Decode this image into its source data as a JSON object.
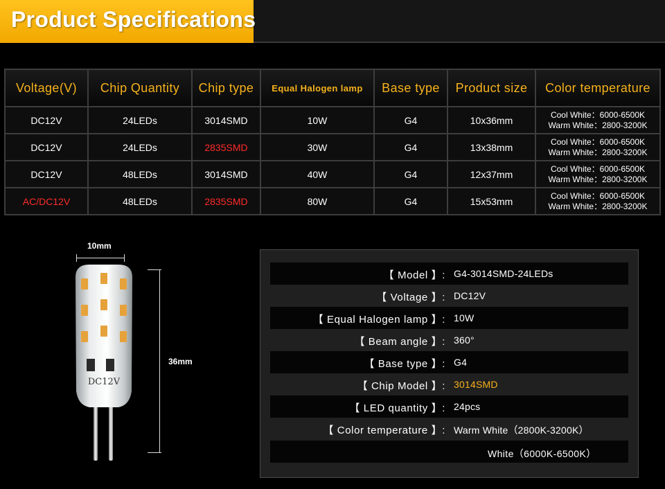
{
  "header": {
    "title": "Product  Specifications"
  },
  "table": {
    "headers": [
      "Voltage(V)",
      "Chip  Quantity",
      "Chip  type",
      "Equal  Halogen  lamp",
      "Base  type",
      "Product  size",
      "Color  temperature"
    ],
    "rows": [
      {
        "voltage": "DC12V",
        "chips": "24LEDs",
        "chip_type": "3014SMD",
        "halogen": "10W",
        "base": "G4",
        "size": "10x36mm",
        "cool": "Cool  White：6000-6500K",
        "warm": "Warm  White：2800-3200K"
      },
      {
        "voltage": "DC12V",
        "chips": "24LEDs",
        "chip_type": "2835SMD",
        "halogen": "30W",
        "base": "G4",
        "size": "13x38mm",
        "cool": "Cool  White：6000-6500K",
        "warm": "Warm  White：2800-3200K"
      },
      {
        "voltage": "DC12V",
        "chips": "48LEDs",
        "chip_type": "3014SMD",
        "halogen": "40W",
        "base": "G4",
        "size": "12x37mm",
        "cool": "Cool  White：6000-6500K",
        "warm": "Warm  White：2800-3200K"
      },
      {
        "voltage": "AC/DC12V",
        "chips": "48LEDs",
        "chip_type": "2835SMD",
        "halogen": "80W",
        "base": "G4",
        "size": "15x53mm",
        "cool": "Cool  White：6000-6500K",
        "warm": "Warm  White：2800-3200K"
      }
    ],
    "highlight_color": "#ff2a2a",
    "header_color": "#f6b21c"
  },
  "bulb": {
    "width_label": "10mm",
    "height_label": "36mm",
    "printed_text": "DC12V"
  },
  "specs": {
    "model_label": "【  Model  】:",
    "model_value": "G4-3014SMD-24LEDs",
    "voltage_label": "【  Voltage  】:",
    "voltage_value": "DC12V",
    "halogen_label": "【  Equal  Halogen  lamp  】:",
    "halogen_value": "10W",
    "beam_label": "【  Beam  angle  】:",
    "beam_value": "360°",
    "base_label": "【  Base  type  】:",
    "base_value": "G4",
    "chip_label": "【  Chip  Model  】:",
    "chip_value": "3014SMD",
    "qty_label": "【  LED  quantity  】:",
    "qty_value": "24pcs",
    "ct_label": "【  Color  temperature  】:",
    "ct_value": "Warm  White（2800K-3200K）",
    "ct_value2": "White（6000K-6500K）"
  }
}
